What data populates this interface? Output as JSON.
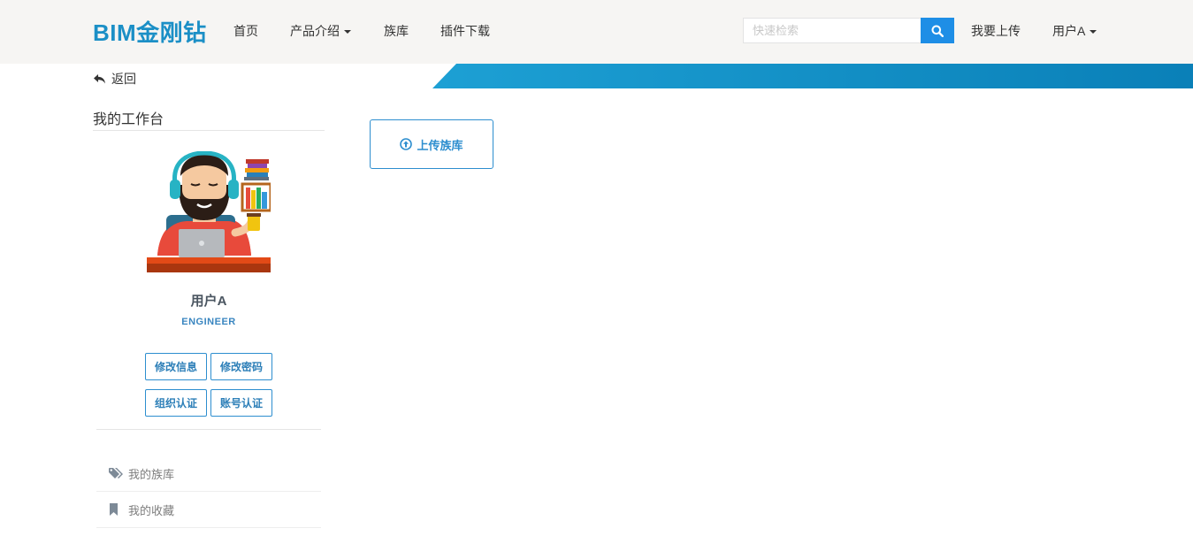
{
  "header": {
    "brand": "BIM金刚钻",
    "nav": {
      "home": "首页",
      "products": "产品介绍",
      "family": "族库",
      "plugins": "插件下载"
    },
    "search_placeholder": "快速检索",
    "upload_link": "我要上传",
    "user_menu": "用户A"
  },
  "back_label": "返回",
  "workspace": {
    "title": "我的工作台",
    "user_name": "用户A",
    "user_role": "ENGINEER",
    "buttons": {
      "edit_info": "修改信息",
      "change_password": "修改密码",
      "org_verify": "组织认证",
      "account_verify": "账号认证"
    },
    "menu": [
      {
        "label": "我的族库",
        "icon": "tags-icon"
      },
      {
        "label": "我的收藏",
        "icon": "bookmark-icon"
      }
    ]
  },
  "main": {
    "upload_family_label": "上传族库"
  },
  "colors": {
    "brand": "#1b8fc6",
    "accent": "#1e8ee6",
    "ribbon": "#0a80b8"
  }
}
